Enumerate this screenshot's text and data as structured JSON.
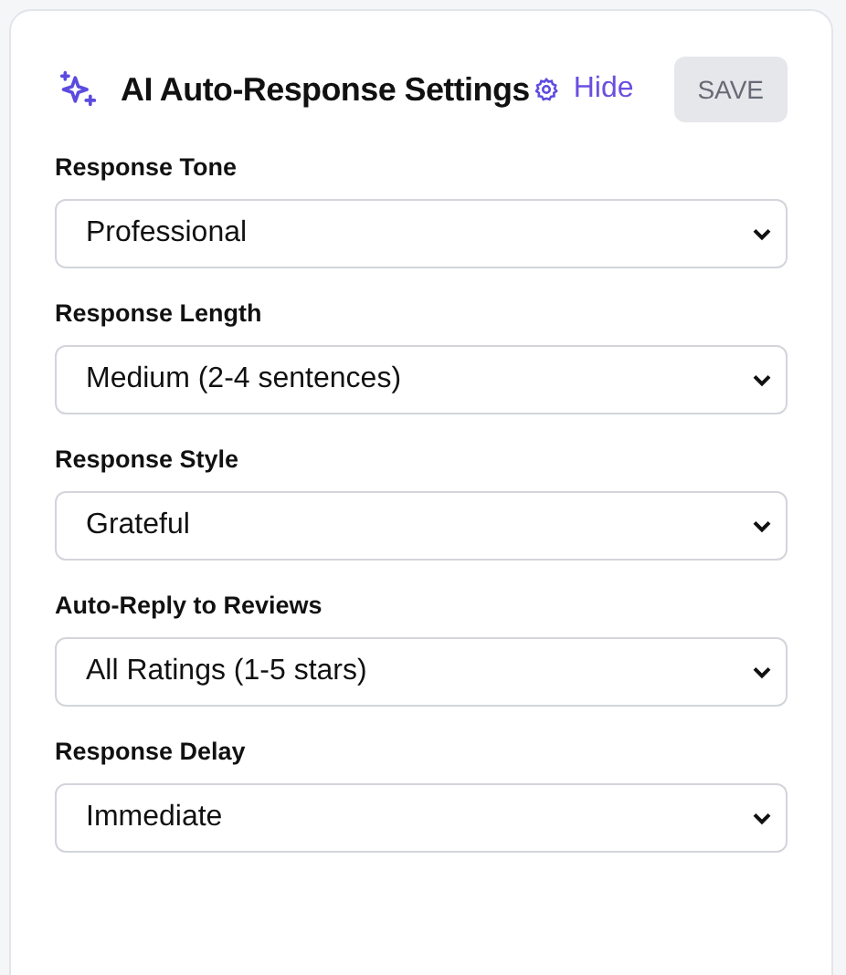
{
  "header": {
    "title": "AI Auto-Response Settings",
    "hide_link": "Hide",
    "save_button": {
      "label": "SAVE",
      "disabled": true
    }
  },
  "fields": [
    {
      "label": "Response Tone",
      "value": "Professional"
    },
    {
      "label": "Response Length",
      "value": "Medium (2-4 sentences)"
    },
    {
      "label": "Response Style",
      "value": "Grateful"
    },
    {
      "label": "Auto-Reply to Reviews",
      "value": "All Ratings (1-5 stars)"
    },
    {
      "label": "Response Delay",
      "value": "Immediate"
    }
  ]
}
